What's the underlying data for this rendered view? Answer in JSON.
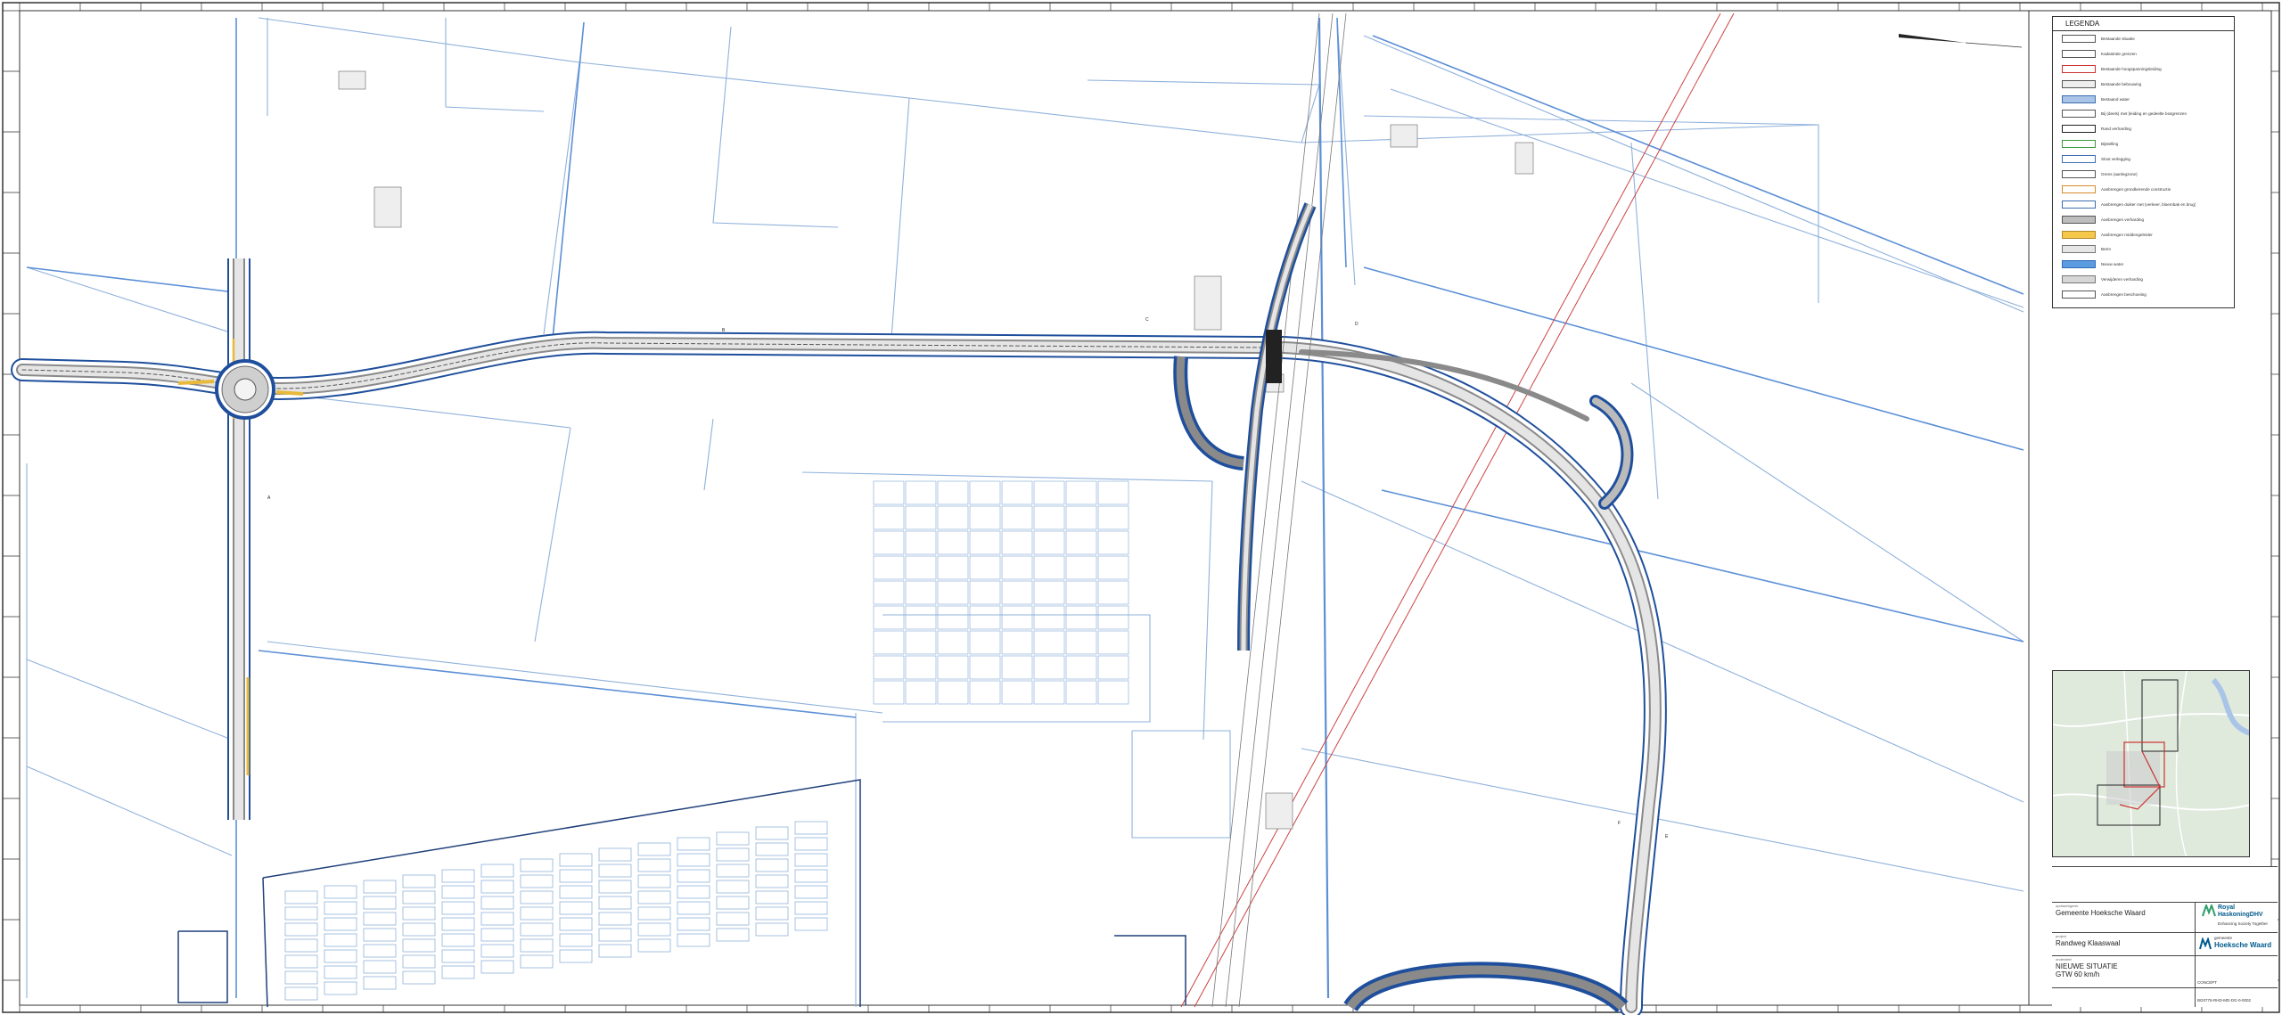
{
  "legend": {
    "title": "LEGENDA",
    "items": [
      {
        "label": "Bestaande situatie",
        "fill": "#ffffff",
        "stroke": "#555555"
      },
      {
        "label": "Kadastrale grenzen",
        "fill": "#ffffff",
        "stroke": "#555555"
      },
      {
        "label": "Bestaande hoogspanningsleiding",
        "fill": "#ffffff",
        "stroke": "#cc3333"
      },
      {
        "label": "Bestaande bebouwing",
        "fill": "#eeeeee",
        "stroke": "#555555"
      },
      {
        "label": "Bestaand water",
        "fill": "#a9c4e6",
        "stroke": "#3d6fb0"
      },
      {
        "label": "Bij (deels) met (leiding en gedeelte bosgrenzen",
        "fill": "#ffffff",
        "stroke": "#555555"
      },
      {
        "label": "Rand verharding",
        "fill": "#ffffff",
        "stroke": "#222222"
      },
      {
        "label": "Bijstelling",
        "fill": "#ffffff",
        "stroke": "#3d9b3d"
      },
      {
        "label": "Sloot verlegging",
        "fill": "#ffffff",
        "stroke": "#3d6fb0"
      },
      {
        "label": "Grens (aanlegzone)",
        "fill": "#ffffff",
        "stroke": "#555555"
      },
      {
        "label": "Aanbrengen grondkerende constructie",
        "fill": "#ffffff",
        "stroke": "#d98a2b"
      },
      {
        "label": "Aanbrengen duiker met (verkeer, bloembak en brug)",
        "fill": "#ffffff",
        "stroke": "#3d6fb0"
      },
      {
        "label": "Aanbrengen verharding",
        "fill": "#bdbdbd",
        "stroke": "#555555"
      },
      {
        "label": "Aanbrengen middengeleider",
        "fill": "#f5c84a",
        "stroke": "#b08b2a"
      },
      {
        "label": "Berm",
        "fill": "#e6e6e6",
        "stroke": "#777777"
      },
      {
        "label": "Nieuw water",
        "fill": "#5b9be0",
        "stroke": "#2f6ab5"
      },
      {
        "label": "Verwijderen verharding",
        "fill": "#d6d6d6",
        "stroke": "#777777"
      },
      {
        "label": "Aanbrengen beschoeiing",
        "fill": "#ffffff",
        "stroke": "#555555"
      }
    ]
  },
  "titleblock": {
    "client_label": "opdrachtgever",
    "client": "Gemeente Hoeksche Waard",
    "project_label": "project",
    "project": "Randweg Klaaswaal",
    "drawing_label": "onderdeel",
    "drawing_line1": "NIEUWE SITUATIE",
    "drawing_line2": "GTW 60 km/h",
    "status": "CONCEPT",
    "drawing_number": "BG0776-RHD-MD-DG-0-0002",
    "logo_client": "Hoeksche Waard",
    "logo_client_top": "gemeente",
    "logo_consultant_1": "Royal",
    "logo_consultant_2": "HaskoningDHV",
    "logo_consultant_sub": "Enhancing Society Together"
  },
  "colors": {
    "road_edge_blue": "#1f4f9c",
    "water_blue": "#5b8fd6",
    "road_grey": "#9a9a9a",
    "median_yellow": "#e8b93a",
    "parcel_line": "#7fa6d6",
    "powerline_red": "#cc4444",
    "frame": "#333333"
  }
}
